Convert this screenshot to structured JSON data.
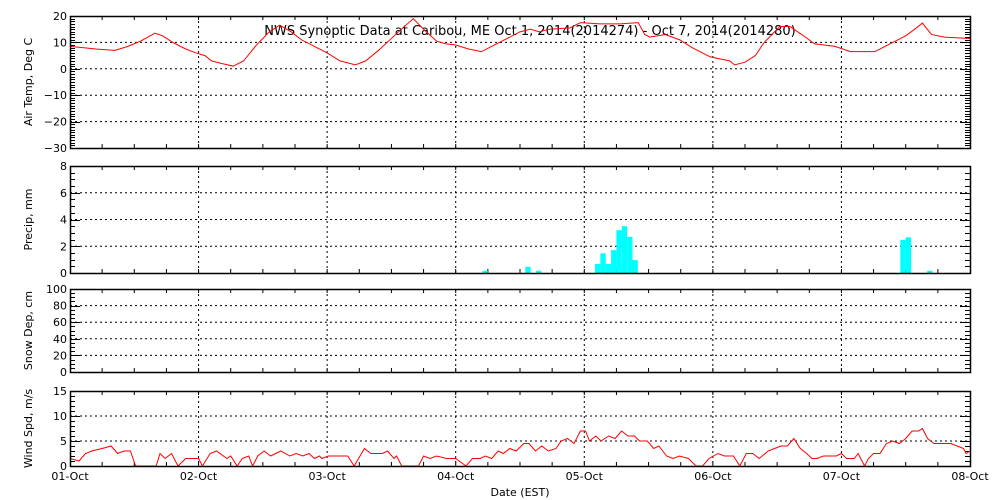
{
  "title": "NWS Synoptic Data at Caribou, ME   Oct  1, 2014(2014274) - Oct  7, 2014(2014280)",
  "colors": {
    "temp": "#ff0000",
    "precip": "#00ffff",
    "wind": "#ff0000",
    "axis": "#000000"
  },
  "chart_data": [
    {
      "type": "line",
      "name": "air-temp",
      "ylabel": "Air Temp, Deg C",
      "ylim": [
        -30,
        20
      ],
      "yticks": [
        -30,
        -20,
        -10,
        0,
        10,
        20
      ],
      "xlim": [
        0,
        7
      ],
      "grid": true,
      "points": [
        [
          0,
          8.5
        ],
        [
          0.1,
          8
        ],
        [
          0.2,
          7.5
        ],
        [
          0.35,
          7
        ],
        [
          0.45,
          8.5
        ],
        [
          0.55,
          10.5
        ],
        [
          0.66,
          13.5
        ],
        [
          0.72,
          12.5
        ],
        [
          0.8,
          10
        ],
        [
          0.9,
          7.5
        ],
        [
          0.98,
          6
        ],
        [
          1.05,
          5
        ],
        [
          1.1,
          3
        ],
        [
          1.18,
          2
        ],
        [
          1.27,
          1
        ],
        [
          1.35,
          3
        ],
        [
          1.45,
          9
        ],
        [
          1.55,
          14
        ],
        [
          1.63,
          16.5
        ],
        [
          1.72,
          14
        ],
        [
          1.8,
          11
        ],
        [
          1.9,
          8.5
        ],
        [
          2.0,
          6
        ],
        [
          2.1,
          3
        ],
        [
          2.22,
          1.5
        ],
        [
          2.3,
          3
        ],
        [
          2.4,
          7
        ],
        [
          2.5,
          11.5
        ],
        [
          2.6,
          16
        ],
        [
          2.67,
          19
        ],
        [
          2.75,
          15
        ],
        [
          2.85,
          10.5
        ],
        [
          2.92,
          9.5
        ],
        [
          3.0,
          9
        ],
        [
          3.1,
          7.5
        ],
        [
          3.2,
          6.5
        ],
        [
          3.34,
          10
        ],
        [
          3.5,
          14
        ],
        [
          3.58,
          15
        ],
        [
          3.65,
          14
        ],
        [
          3.73,
          15
        ],
        [
          3.89,
          15.5
        ],
        [
          3.97,
          17.5
        ],
        [
          4.12,
          17
        ],
        [
          4.28,
          17
        ],
        [
          4.42,
          17.5
        ],
        [
          4.47,
          13
        ],
        [
          4.51,
          12
        ],
        [
          4.63,
          13
        ],
        [
          4.74,
          11
        ],
        [
          4.84,
          8
        ],
        [
          4.98,
          4.5
        ],
        [
          5.13,
          3
        ],
        [
          5.17,
          1.5
        ],
        [
          5.25,
          2.5
        ],
        [
          5.33,
          5
        ],
        [
          5.4,
          10
        ],
        [
          5.52,
          16
        ],
        [
          5.6,
          16
        ],
        [
          5.72,
          12
        ],
        [
          5.79,
          9.5
        ],
        [
          5.95,
          8.5
        ],
        [
          6.07,
          6.5
        ],
        [
          6.26,
          6.5
        ],
        [
          6.38,
          9.5
        ],
        [
          6.5,
          12.5
        ],
        [
          6.57,
          15
        ],
        [
          6.63,
          17.3
        ],
        [
          6.7,
          13
        ],
        [
          6.8,
          12
        ],
        [
          7.0,
          11.5
        ]
      ]
    },
    {
      "type": "bar",
      "name": "precip",
      "ylabel": "Precip, mm",
      "ylim": [
        0,
        8
      ],
      "yticks": [
        0,
        2,
        4,
        6,
        8
      ],
      "xlim": [
        0,
        7
      ],
      "grid": true,
      "bar_width_hours": 1,
      "bars": [
        [
          77,
          0.17
        ],
        [
          85,
          0.46
        ],
        [
          87,
          0.17
        ],
        [
          98,
          0.67
        ],
        [
          99,
          1.47
        ],
        [
          100,
          0.67
        ],
        [
          101,
          1.71
        ],
        [
          102,
          3.2
        ],
        [
          103,
          3.5
        ],
        [
          104,
          2.7
        ],
        [
          105,
          0.96
        ],
        [
          155,
          2.48
        ],
        [
          156,
          2.67
        ],
        [
          160,
          0.17
        ]
      ]
    },
    {
      "type": "line",
      "name": "snow-depth",
      "ylabel": "Snow Dep, cm",
      "ylim": [
        0,
        100
      ],
      "yticks": [
        0,
        20,
        40,
        60,
        80,
        100
      ],
      "xlim": [
        0,
        7
      ],
      "grid": true,
      "points": []
    },
    {
      "type": "line",
      "name": "wind-speed",
      "ylabel": "Wind Spd, m/s",
      "xlabel": "Date (EST)",
      "ylim": [
        0,
        15
      ],
      "yticks": [
        0,
        5,
        10,
        15
      ],
      "xlim": [
        0,
        7
      ],
      "grid": true,
      "points": [
        [
          0,
          1.5
        ],
        [
          0.07,
          1
        ],
        [
          0.12,
          2.5
        ],
        [
          0.17,
          3
        ],
        [
          0.25,
          3.5
        ],
        [
          0.32,
          4
        ],
        [
          0.37,
          2.5
        ],
        [
          0.42,
          3
        ],
        [
          0.47,
          3
        ],
        [
          0.51,
          0
        ],
        [
          0.67,
          0
        ],
        [
          0.7,
          2.5
        ],
        [
          0.74,
          1.5
        ],
        [
          0.79,
          2.5
        ],
        [
          0.84,
          0
        ],
        [
          0.9,
          1.5
        ],
        [
          1.0,
          1.5
        ],
        [
          1.03,
          0
        ],
        [
          1.09,
          2.5
        ],
        [
          1.14,
          3
        ],
        [
          1.22,
          1.5
        ],
        [
          1.25,
          2
        ],
        [
          1.3,
          0
        ],
        [
          1.34,
          1.5
        ],
        [
          1.39,
          2
        ],
        [
          1.42,
          0
        ],
        [
          1.46,
          2
        ],
        [
          1.51,
          3
        ],
        [
          1.56,
          2
        ],
        [
          1.64,
          3
        ],
        [
          1.71,
          2
        ],
        [
          1.76,
          2.5
        ],
        [
          1.81,
          2
        ],
        [
          1.86,
          2.5
        ],
        [
          1.9,
          1.5
        ],
        [
          1.94,
          2
        ],
        [
          1.96,
          1.5
        ],
        [
          2.01,
          2
        ],
        [
          2.16,
          2
        ],
        [
          2.21,
          0
        ],
        [
          2.29,
          3.5
        ],
        [
          2.34,
          2.5
        ],
        [
          2.43,
          2.5
        ],
        [
          2.47,
          3
        ],
        [
          2.52,
          1.5
        ],
        [
          2.54,
          2
        ],
        [
          2.58,
          0
        ],
        [
          2.71,
          0
        ],
        [
          2.75,
          2
        ],
        [
          2.8,
          1.5
        ],
        [
          2.85,
          2
        ],
        [
          2.93,
          1.5
        ],
        [
          3.0,
          1.5
        ],
        [
          3.08,
          0
        ],
        [
          3.13,
          1.5
        ],
        [
          3.19,
          1.5
        ],
        [
          3.23,
          2
        ],
        [
          3.28,
          1.5
        ],
        [
          3.33,
          3
        ],
        [
          3.37,
          2.5
        ],
        [
          3.42,
          3.5
        ],
        [
          3.47,
          3
        ],
        [
          3.53,
          4.5
        ],
        [
          3.57,
          4.5
        ],
        [
          3.62,
          3
        ],
        [
          3.67,
          4
        ],
        [
          3.72,
          3
        ],
        [
          3.78,
          3.5
        ],
        [
          3.82,
          5
        ],
        [
          3.87,
          5.5
        ],
        [
          3.92,
          4.5
        ],
        [
          3.97,
          7
        ],
        [
          4.01,
          7
        ],
        [
          4.04,
          5
        ],
        [
          4.09,
          6
        ],
        [
          4.13,
          5
        ],
        [
          4.19,
          6
        ],
        [
          4.24,
          5.5
        ],
        [
          4.29,
          7
        ],
        [
          4.34,
          6
        ],
        [
          4.39,
          6
        ],
        [
          4.43,
          5
        ],
        [
          4.49,
          5
        ],
        [
          4.54,
          3.5
        ],
        [
          4.58,
          4
        ],
        [
          4.64,
          2
        ],
        [
          4.69,
          1.5
        ],
        [
          4.74,
          2
        ],
        [
          4.81,
          1.5
        ],
        [
          4.87,
          0
        ],
        [
          4.92,
          0
        ],
        [
          4.97,
          1.5
        ],
        [
          5.04,
          2.5
        ],
        [
          5.09,
          2
        ],
        [
          5.16,
          2
        ],
        [
          5.21,
          0
        ],
        [
          5.26,
          2.5
        ],
        [
          5.31,
          2.5
        ],
        [
          5.36,
          1.5
        ],
        [
          5.43,
          3
        ],
        [
          5.48,
          3.5
        ],
        [
          5.53,
          4
        ],
        [
          5.58,
          4
        ],
        [
          5.63,
          5.5
        ],
        [
          5.68,
          3.5
        ],
        [
          5.73,
          2.5
        ],
        [
          5.77,
          1.5
        ],
        [
          5.81,
          1.5
        ],
        [
          5.86,
          2
        ],
        [
          5.96,
          2
        ],
        [
          6.0,
          2.5
        ],
        [
          6.04,
          1.5
        ],
        [
          6.1,
          1.5
        ],
        [
          6.13,
          2.5
        ],
        [
          6.18,
          0
        ],
        [
          6.21,
          1.5
        ],
        [
          6.25,
          2.5
        ],
        [
          6.3,
          2.5
        ],
        [
          6.35,
          4.5
        ],
        [
          6.4,
          5
        ],
        [
          6.45,
          4.5
        ],
        [
          6.5,
          5.5
        ],
        [
          6.55,
          7
        ],
        [
          6.6,
          7
        ],
        [
          6.63,
          7.5
        ],
        [
          6.67,
          5.5
        ],
        [
          6.72,
          4.5
        ],
        [
          6.85,
          4.5
        ],
        [
          6.9,
          4
        ],
        [
          6.95,
          3.5
        ],
        [
          6.97,
          2.5
        ],
        [
          7.0,
          3
        ]
      ]
    }
  ],
  "x_tick_labels": [
    "01-Oct",
    "02-Oct",
    "03-Oct",
    "04-Oct",
    "05-Oct",
    "06-Oct",
    "07-Oct",
    "08-Oct"
  ],
  "xlabel": "Date (EST)"
}
